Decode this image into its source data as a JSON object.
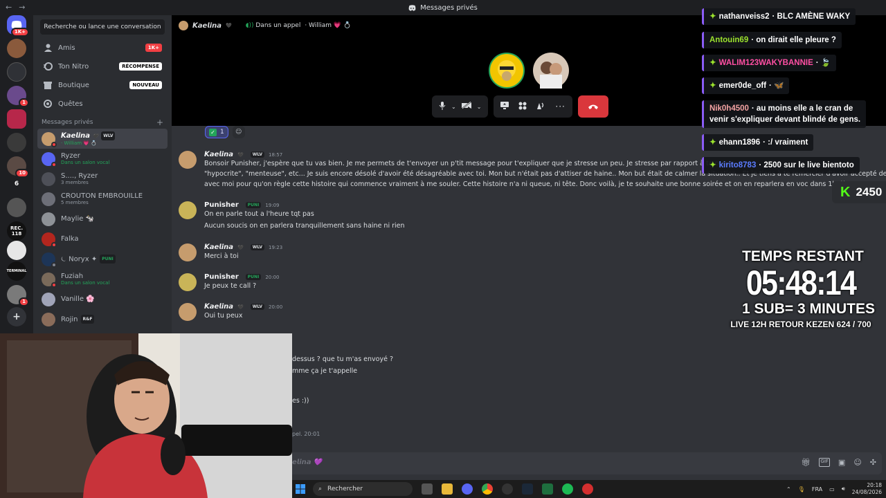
{
  "window": {
    "title": "Messages privés",
    "back": "←",
    "forward": "→"
  },
  "servers": [
    {
      "badge": "1K+"
    },
    {
      "badge": ""
    },
    {
      "badge": ""
    },
    {
      "badge": "1"
    },
    {
      "badge": ""
    },
    {
      "badge": ""
    },
    {
      "badge": "10"
    },
    {
      "label": "6"
    },
    {
      "badge": ""
    },
    {
      "label": "REC. 118"
    },
    {
      "badge": ""
    },
    {
      "label": "TERMINAL",
      "badge": "1"
    },
    {
      "badge": "1"
    }
  ],
  "sidebar": {
    "search": "Recherche ou lance une conversation",
    "nav": [
      {
        "label": "Amis",
        "tag": "1K+",
        "icon": "friends-icon"
      },
      {
        "label": "Ton Nitro",
        "tag": "RÉCOMPENSE",
        "icon": "nitro-icon"
      },
      {
        "label": "Boutique",
        "tag": "NOUVEAU",
        "icon": "shop-icon"
      },
      {
        "label": "Quêtes",
        "tag": "",
        "icon": "quests-icon"
      }
    ],
    "dm_header": "Messages privés",
    "dm_add": "+",
    "dms": [
      {
        "name": "𝙆𝙖𝙚𝙡𝙞𝙣𝙖",
        "extra": "🖤",
        "tag": "WLV",
        "sub": "· William 💗 💍",
        "color": "#c69c6d"
      },
      {
        "name": "Ryzer",
        "sub": "Dans un salon vocal",
        "color": "#5865f2"
      },
      {
        "name": "S...., Ryzer",
        "sub": "3 membres",
        "color": "#4e5058"
      },
      {
        "name": "CROUTON EMBROUILLE",
        "sub": "5 membres",
        "color": "#6d6f78"
      },
      {
        "name": "Maylie 🐄",
        "sub": "",
        "color": "#8e9297"
      },
      {
        "name": "Falka",
        "sub": "",
        "color": "#b3261e"
      },
      {
        "name": "⏾ Noryx ✦",
        "tag": "PUNI",
        "sub": "",
        "color": "#1d3557"
      },
      {
        "name": "Fuziah",
        "sub": "Dans un salon vocal",
        "color": "#7a6a5a"
      },
      {
        "name": "Vanille 🌸",
        "sub": "",
        "color": "#a0a4b8"
      },
      {
        "name": "Rojin",
        "tag": "R&F",
        "sub": "",
        "color": "#8a6c5a"
      }
    ]
  },
  "call": {
    "user": "𝙆𝙖𝙚𝙡𝙞𝙣𝙖",
    "heart": "🖤",
    "status": "Dans un appel",
    "with": "· William 💗 💍"
  },
  "messages": {
    "reaction_count": "1",
    "items": [
      {
        "author": "𝙆𝙖𝙚𝙡𝙞𝙣𝙖",
        "heart": "🖤",
        "tag": "WLV",
        "time": "18:57",
        "lines": [
          "Bonsoir Punisher, j'espère que tu vas bien. Je me permets de t'envoyer un p'tit message pour t'expliquer que je stresse un peu. Je stresse par rapport à ta comm",
          "\"hypocrite\", \"menteuse\", etc... Je suis encore désolé d'avoir été désagréable avec toi. Mon but n'était pas d'attiser de haine.. Mon but était de calmer la situation.. Et je tiens à te remercier d'avoir accepté de parler",
          "avec moi pour qu'on règle cette histoire qui commence vraiment à me souler. Cette histoire n'a ni queue, ni tête. Donc voilà, je te souhaite une bonne soirée et on en reparlera en voc dans 1h :))"
        ]
      },
      {
        "author": "Punisher",
        "tag": "PUNI",
        "time": "19:09",
        "lines": [
          "On en parle tout a l'heure tqt pas",
          "Aucun soucis on en parlera tranquillement sans haine ni rien"
        ]
      },
      {
        "author": "𝙆𝙖𝙚𝙡𝙞𝙣𝙖",
        "heart": "🖤",
        "tag": "WLV",
        "time": "19:23",
        "lines": [
          "Merci à toi"
        ]
      },
      {
        "author": "Punisher",
        "tag": "PUNI",
        "time": "20:00",
        "lines": [
          "Je peux te call ?"
        ]
      },
      {
        "author": "𝙆𝙖𝙚𝙡𝙞𝙣𝙖",
        "heart": "🖤",
        "tag": "WLV",
        "time": "20:00",
        "lines": [
          "Oui tu peux"
        ]
      }
    ],
    "partials": [
      "dessus ? que tu m'as envoyé ?",
      "mme ça je t'appelle",
      "es :))",
      "pel. 20:01"
    ]
  },
  "composer": {
    "placeholder": "𝙚𝙡𝙞𝙣𝙖 💜"
  },
  "stream_chat": [
    {
      "user": "nathanveiss2",
      "text": "· BLC AMÈNE WAKY",
      "user_color": "#ffffff",
      "star": true
    },
    {
      "user": "Antouin69",
      "text": "· on dirait elle pleure ?",
      "user_color": "#9be22d",
      "star": false
    },
    {
      "user": "WALIM123WAKYBANNIE",
      "text": "· 🍃",
      "user_color": "#ff4fa3",
      "star": true
    },
    {
      "user": "emer0de_off",
      "text": "· 🦋",
      "user_color": "#ffffff",
      "star": true
    },
    {
      "user": "Nik0h4500",
      "text": "· au moins elle a le cran de",
      "text2": "venir s'expliquer devant blindé de gens.",
      "user_color": "#f4a3a3",
      "star": false
    },
    {
      "user": "ehann1896",
      "text": "· :/ vraiment",
      "user_color": "#ffffff",
      "star": true
    },
    {
      "user": "kirito8783",
      "text": "· 2500 sur le live bientoto",
      "user_color": "#5b7cff",
      "star": true
    }
  ],
  "kick": {
    "logo": "K",
    "count": "2450"
  },
  "timer": {
    "title": "TEMPS RESTANT",
    "time": "05:48:14",
    "rule": "1 SUB= 3 MINUTES",
    "goal": "LIVE 12H RETOUR KEZEN 624 / 700"
  },
  "taskbar": {
    "search": "Rechercher",
    "lang": "FRA",
    "time": "20:18",
    "date": "24/08/2026"
  },
  "colors": {
    "accent": "#5865f2",
    "danger": "#da373c",
    "online": "#23a55a",
    "kick": "#53fc18"
  }
}
